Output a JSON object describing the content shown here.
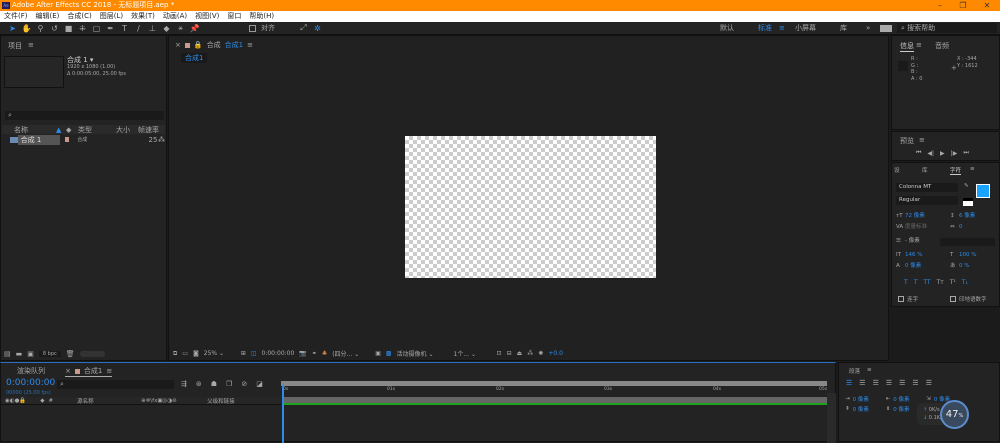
{
  "title": "Adobe After Effects CC 2018 - 无标题项目.aep *",
  "window_controls": {
    "minimize": "–",
    "restore": "❐",
    "close": "✕"
  },
  "menu": [
    "文件(F)",
    "编辑(E)",
    "合成(C)",
    "图层(L)",
    "效果(T)",
    "动画(A)",
    "视图(V)",
    "窗口",
    "帮助(H)"
  ],
  "toolbar": {
    "align_label": "对齐",
    "workspaces": [
      "默认",
      "标准",
      "小屏幕",
      "库"
    ],
    "active_workspace": "标准",
    "more": "»",
    "search_placeholder": "搜索帮助"
  },
  "project": {
    "title": "项目",
    "comp_name": "合成 1 ▾",
    "comp_size": "1920 x 1080 (1.00)",
    "comp_duration": "Δ 0:00:05:00, 25.00 fps",
    "search_placeholder": "",
    "columns": [
      "名称",
      "类型",
      "大小",
      "帧速率"
    ],
    "items": [
      {
        "name": "合成 1",
        "type": "合成",
        "size": "",
        "fps": "25"
      }
    ],
    "bpc": "8 bpc"
  },
  "composition": {
    "tab_prefix": "合成",
    "tab_name": "合成1",
    "breadcrumb": "合成1",
    "zoom": "25%",
    "timecode": "0:00:00:00",
    "resolution": "(四分...",
    "camera": "活动摄像机",
    "views": "1个...",
    "exposure": "+0.0"
  },
  "info": {
    "tabs": [
      "信息",
      "音频"
    ],
    "r": "R :",
    "g": "G :",
    "b": "B :",
    "a": "A : 0",
    "x": "X : -344",
    "y": "Y : 1612"
  },
  "preview": {
    "title": "预览"
  },
  "character": {
    "tabs": [
      "设",
      "库",
      "字符"
    ],
    "font": "Colonna MT",
    "style": "Regular",
    "size": "72 像素",
    "leading": "6 像素",
    "kerning": "度量标准",
    "tracking": "0",
    "stroke": "- 像素",
    "vscale": "146 %",
    "hscale": "100 %",
    "baseline": "0 像素",
    "tsume": "0 %",
    "ligature": "连字",
    "hindi": "印地语数字",
    "fill_color": "#1aa3ff"
  },
  "paragraph": {
    "title": "段落",
    "indent_left": "0 像素",
    "indent_first": "0 像素",
    "indent_right": "0 像素",
    "space_before": "0 像素",
    "space_after": "0 像素"
  },
  "network": {
    "up": "0K/s",
    "down": "0.1K/s",
    "percent": "47",
    "unit": "%"
  },
  "timeline": {
    "render_queue": "渲染队列",
    "tab": "合成1",
    "timecode": "0:00:00:00",
    "frame_info": "00000 (25.00 fps)",
    "layer_name_col": "源名称",
    "parent_col": "父级和链接",
    "ticks": [
      "0s",
      "01s",
      "02s",
      "03s",
      "04s",
      "05s"
    ]
  }
}
